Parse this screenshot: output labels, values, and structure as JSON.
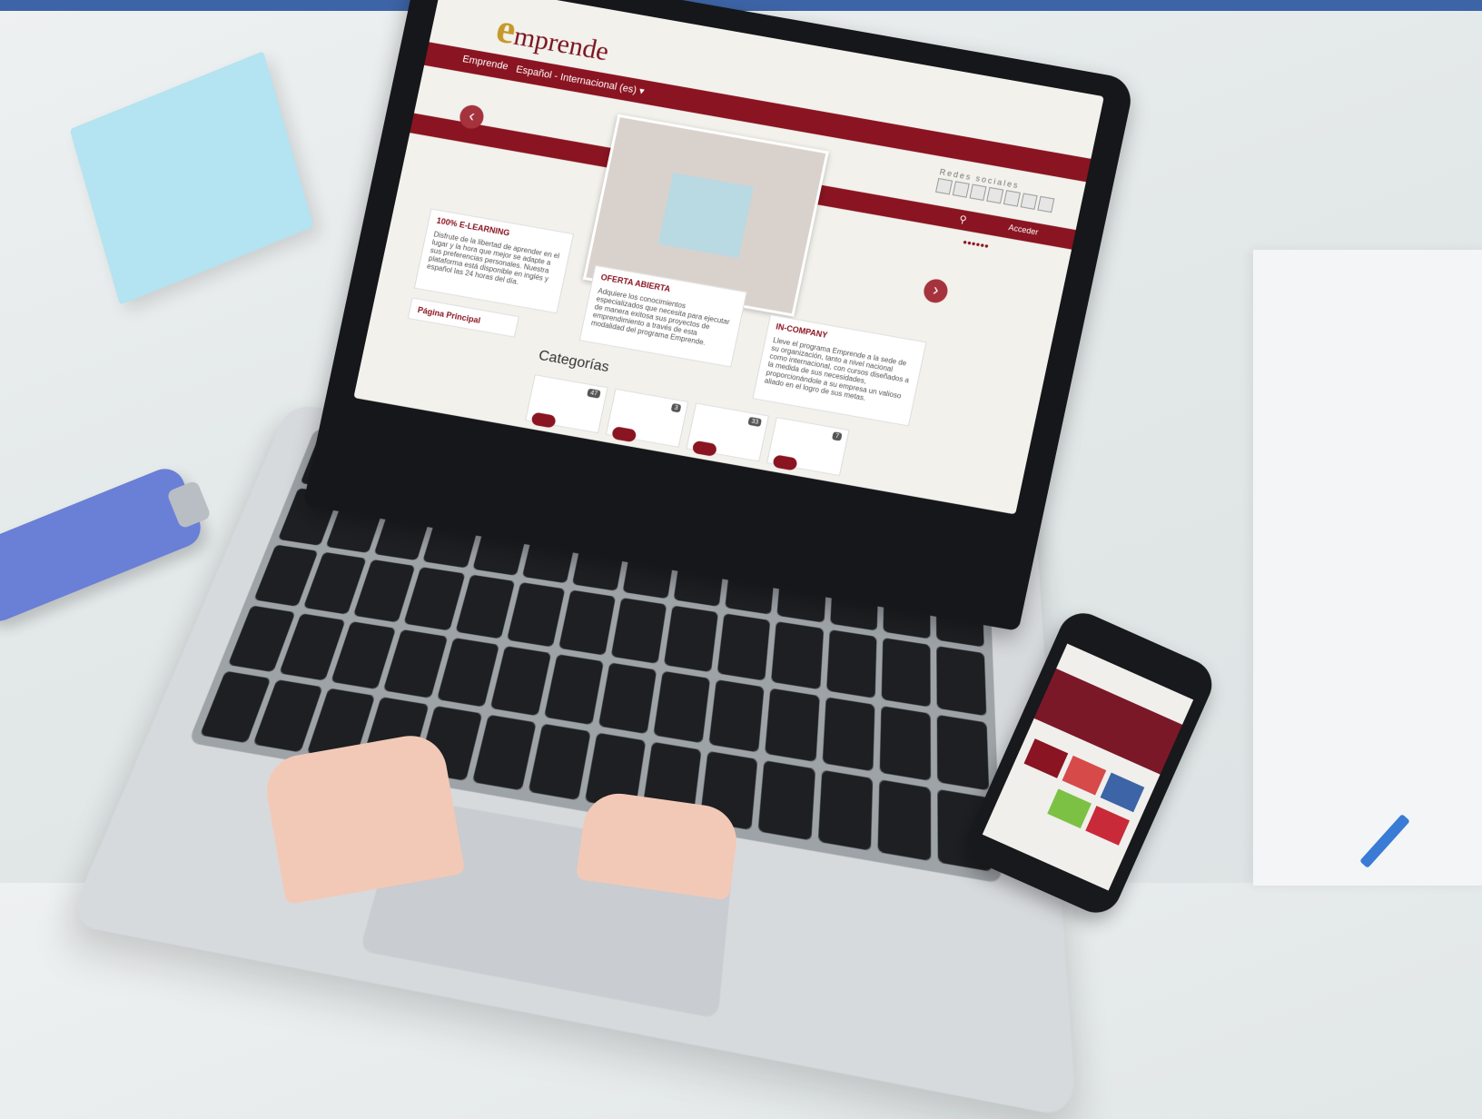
{
  "colors": {
    "topbar": "#3d64a7",
    "brand_red": "#8a1421",
    "brand_gold": "#c59a2b",
    "desk": "#e3e8e8"
  },
  "site": {
    "logo_text": "mprende",
    "nav_home": "Emprende",
    "nav_language": "Español - Internacional (es) ▾",
    "social_title": "Redes sociales",
    "login": "Acceder",
    "cards": [
      {
        "title": "100% E-LEARNING",
        "text": "Disfrute de la libertad de aprender en el lugar y la hora que mejor se adapte a sus preferencias personales. Nuestra plataforma está disponible en inglés y español las 24 horas del día."
      },
      {
        "title": "OFERTA ABIERTA",
        "text": "Adquiere los conocimientos especializados que necesita para ejecutar de manera exitosa sus proyectos de emprendimiento a través de esta modalidad del programa Emprende."
      },
      {
        "title": "IN-COMPANY",
        "text": "Lleve el programa Emprende a la sede de su organización, tanto a nivel nacional como internacional, con cursos diseñados a la medida de sus necesidades, proporcionándole a su empresa un valioso aliado en el logro de sus metas."
      }
    ],
    "main_page": "Página Principal",
    "categories_title": "Categorías",
    "category_counts": [
      "47",
      "3",
      "33",
      "7"
    ]
  },
  "icons": [
    "chevron-left-icon",
    "chevron-right-icon",
    "search-icon",
    "gear-icon",
    "login-icon",
    "flag-icon"
  ]
}
